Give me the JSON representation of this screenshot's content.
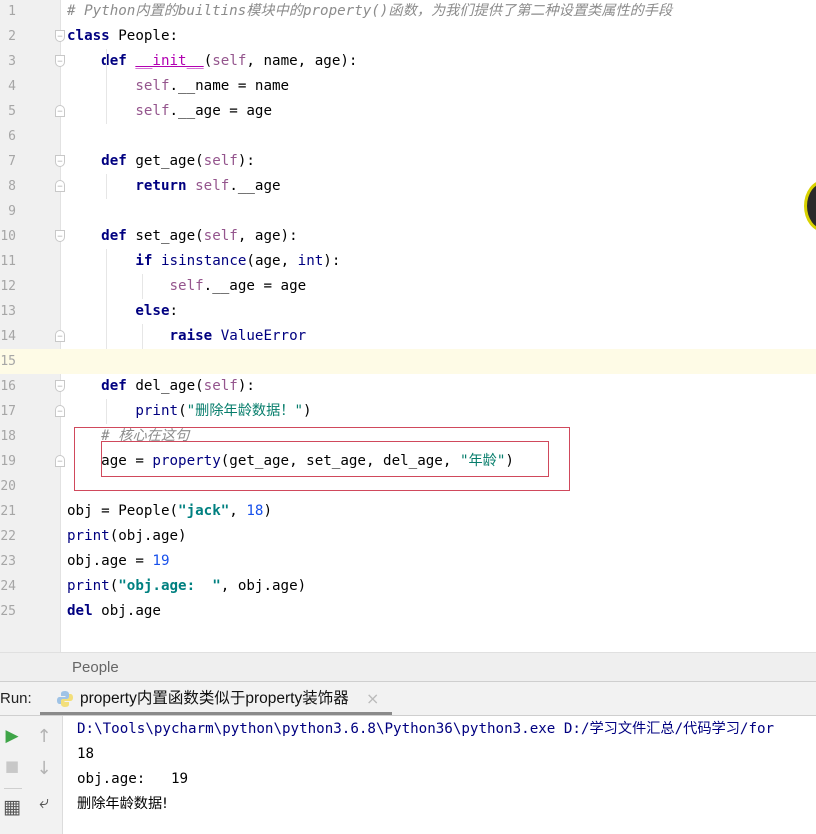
{
  "editor": {
    "lines": [
      {
        "n": "1",
        "tokens": [
          {
            "t": "# Python内置的builtins模块中的property()函数，为我们提供了第二种设置类属性的手段",
            "c": "cmt"
          }
        ]
      },
      {
        "n": "2",
        "fold": "open",
        "tokens": [
          {
            "t": "class",
            "c": "kw"
          },
          {
            "t": " People:",
            "c": "pc"
          }
        ]
      },
      {
        "n": "3",
        "fold": "open",
        "tokens": [
          {
            "t": "    "
          },
          {
            "t": "def",
            "c": "kw"
          },
          {
            "t": " "
          },
          {
            "t": "__init__",
            "c": "magic"
          },
          {
            "t": "("
          },
          {
            "t": "self",
            "c": "slf"
          },
          {
            "t": ", name, age):"
          }
        ]
      },
      {
        "n": "4",
        "tokens": [
          {
            "t": "        "
          },
          {
            "t": "self",
            "c": "slf"
          },
          {
            "t": ".__name = name"
          }
        ]
      },
      {
        "n": "5",
        "fold": "close",
        "tokens": [
          {
            "t": "        "
          },
          {
            "t": "self",
            "c": "slf"
          },
          {
            "t": ".__age = age"
          }
        ]
      },
      {
        "n": "6",
        "tokens": []
      },
      {
        "n": "7",
        "fold": "open",
        "tokens": [
          {
            "t": "    "
          },
          {
            "t": "def",
            "c": "kw"
          },
          {
            "t": " get_age("
          },
          {
            "t": "self",
            "c": "slf"
          },
          {
            "t": "):"
          }
        ]
      },
      {
        "n": "8",
        "fold": "close",
        "tokens": [
          {
            "t": "        "
          },
          {
            "t": "return",
            "c": "kw"
          },
          {
            "t": " "
          },
          {
            "t": "self",
            "c": "slf"
          },
          {
            "t": ".__age"
          }
        ]
      },
      {
        "n": "9",
        "tokens": []
      },
      {
        "n": "10",
        "fold": "open",
        "tokens": [
          {
            "t": "    "
          },
          {
            "t": "def",
            "c": "kw"
          },
          {
            "t": " set_age("
          },
          {
            "t": "self",
            "c": "slf"
          },
          {
            "t": ", age):"
          }
        ]
      },
      {
        "n": "11",
        "tokens": [
          {
            "t": "        "
          },
          {
            "t": "if",
            "c": "kw"
          },
          {
            "t": " "
          },
          {
            "t": "isinstance",
            "c": "bi"
          },
          {
            "t": "(age, "
          },
          {
            "t": "int",
            "c": "bi"
          },
          {
            "t": "):"
          }
        ]
      },
      {
        "n": "12",
        "tokens": [
          {
            "t": "            "
          },
          {
            "t": "self",
            "c": "slf"
          },
          {
            "t": ".__age = age"
          }
        ]
      },
      {
        "n": "13",
        "tokens": [
          {
            "t": "        "
          },
          {
            "t": "else",
            "c": "kw"
          },
          {
            "t": ":"
          }
        ]
      },
      {
        "n": "14",
        "fold": "close",
        "tokens": [
          {
            "t": "            "
          },
          {
            "t": "raise",
            "c": "kw"
          },
          {
            "t": " "
          },
          {
            "t": "ValueError",
            "c": "bi"
          }
        ]
      },
      {
        "n": "15",
        "current": true,
        "tokens": []
      },
      {
        "n": "16",
        "fold": "open",
        "tokens": [
          {
            "t": "    "
          },
          {
            "t": "def",
            "c": "kw"
          },
          {
            "t": " del_age("
          },
          {
            "t": "self",
            "c": "slf"
          },
          {
            "t": "):"
          }
        ]
      },
      {
        "n": "17",
        "fold": "close",
        "tokens": [
          {
            "t": "        "
          },
          {
            "t": "print",
            "c": "bi"
          },
          {
            "t": "("
          },
          {
            "t": "\"删除年龄数据！\"",
            "c": "strn"
          },
          {
            "t": ")"
          }
        ]
      },
      {
        "n": "18",
        "tokens": [
          {
            "t": "    "
          },
          {
            "t": "# 核心在这句",
            "c": "cmt"
          }
        ]
      },
      {
        "n": "19",
        "fold": "close",
        "tokens": [
          {
            "t": "    age = "
          },
          {
            "t": "property",
            "c": "bi"
          },
          {
            "t": "(get_age, set_age, del_age, "
          },
          {
            "t": "\"年龄\"",
            "c": "strn"
          },
          {
            "t": ")"
          }
        ]
      },
      {
        "n": "20",
        "tokens": []
      },
      {
        "n": "21",
        "tokens": [
          {
            "t": "obj = People("
          },
          {
            "t": "\"jack\"",
            "c": "str"
          },
          {
            "t": ", "
          },
          {
            "t": "18",
            "c": "num"
          },
          {
            "t": ")"
          }
        ]
      },
      {
        "n": "22",
        "tokens": [
          {
            "t": "print",
            "c": "bi"
          },
          {
            "t": "(obj.age)"
          }
        ]
      },
      {
        "n": "23",
        "tokens": [
          {
            "t": "obj.age = "
          },
          {
            "t": "19",
            "c": "num"
          }
        ]
      },
      {
        "n": "24",
        "tokens": [
          {
            "t": "print",
            "c": "bi"
          },
          {
            "t": "("
          },
          {
            "t": "\"obj.age:  \"",
            "c": "str"
          },
          {
            "t": ", obj.age)"
          }
        ]
      },
      {
        "n": "25",
        "tokens": [
          {
            "t": "del",
            "c": "kw"
          },
          {
            "t": " obj.age"
          }
        ]
      }
    ]
  },
  "breadcrumb": {
    "items": [
      "People"
    ]
  },
  "run_panel": {
    "label": "Run:",
    "tab_title": "property内置函数类似于property装饰器",
    "close_icon": "×",
    "output": [
      {
        "text": "D:\\Tools\\pycharm\\python\\python3.6.8\\Python36\\python3.exe D:/学习文件汇总/代码学习/for",
        "kind": "cmd"
      },
      {
        "text": "18",
        "kind": "plain"
      },
      {
        "text": "obj.age:   19",
        "kind": "plain"
      },
      {
        "text": "删除年龄数据!",
        "kind": "cn"
      }
    ],
    "tools": {
      "run_icon": "▶",
      "stop_icon": "■",
      "up_icon": "↑",
      "down_icon": "↓",
      "wrap_icon": "⤶",
      "layout_icon": "▦"
    }
  },
  "colors": {
    "highlight_box": "#d0495c",
    "current_line": "#fefbe6",
    "run_green": "#3fa548"
  }
}
